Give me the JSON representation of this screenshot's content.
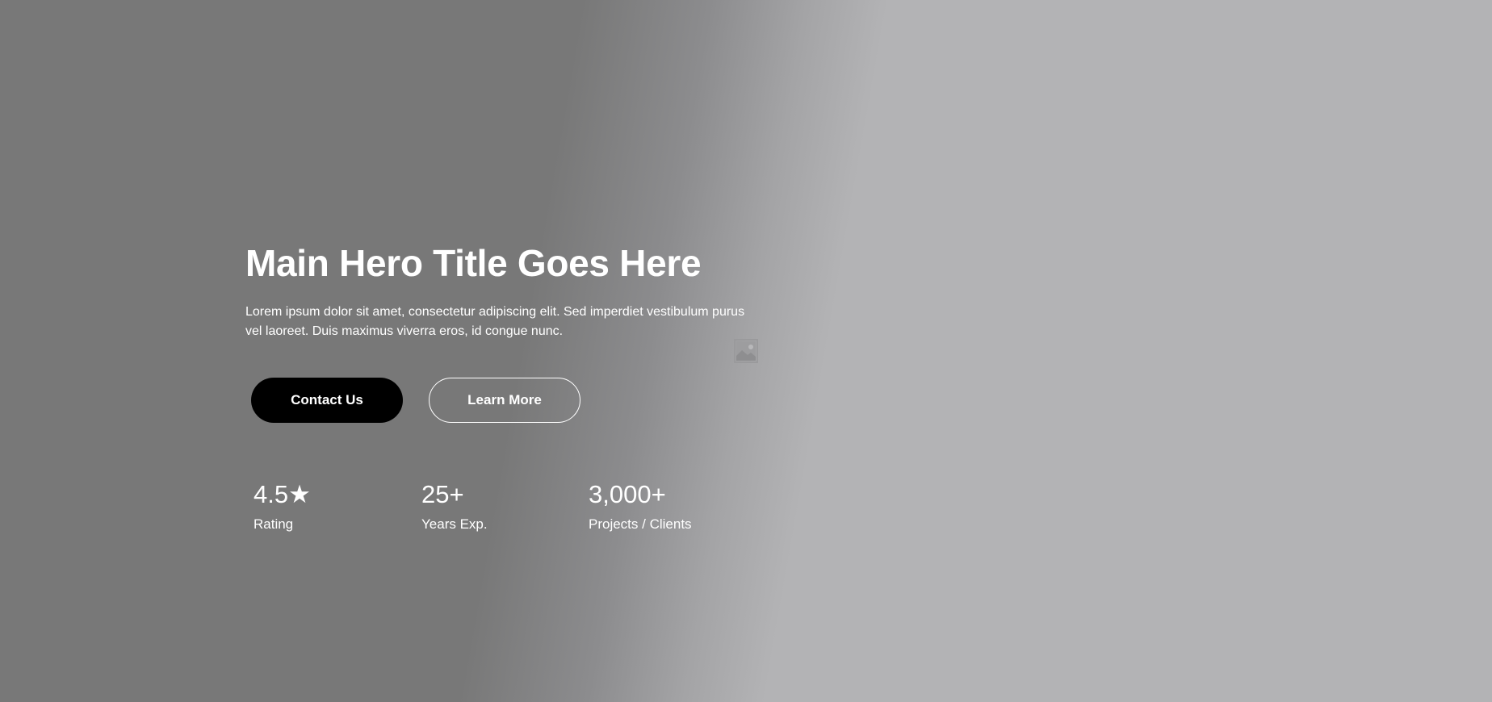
{
  "hero": {
    "title": "Main Hero Title Goes Here",
    "description": "Lorem ipsum dolor sit amet, consectetur adipiscing elit. Sed imperdiet vestibulum purus vel laoreet. Duis maximus viverra eros, id congue nunc.",
    "image_icon": "image-placeholder-icon"
  },
  "buttons": {
    "primary_label": "Contact Us",
    "secondary_label": "Learn More"
  },
  "stats": [
    {
      "value": "4.5★",
      "label": "Rating"
    },
    {
      "value": "25+",
      "label": "Years Exp."
    },
    {
      "value": "3,000+",
      "label": "Projects / Clients"
    }
  ],
  "colors": {
    "text": "#ffffff",
    "primary_button_bg": "#000000",
    "background_dark": "#787878",
    "background_light": "#b3b3b5"
  }
}
